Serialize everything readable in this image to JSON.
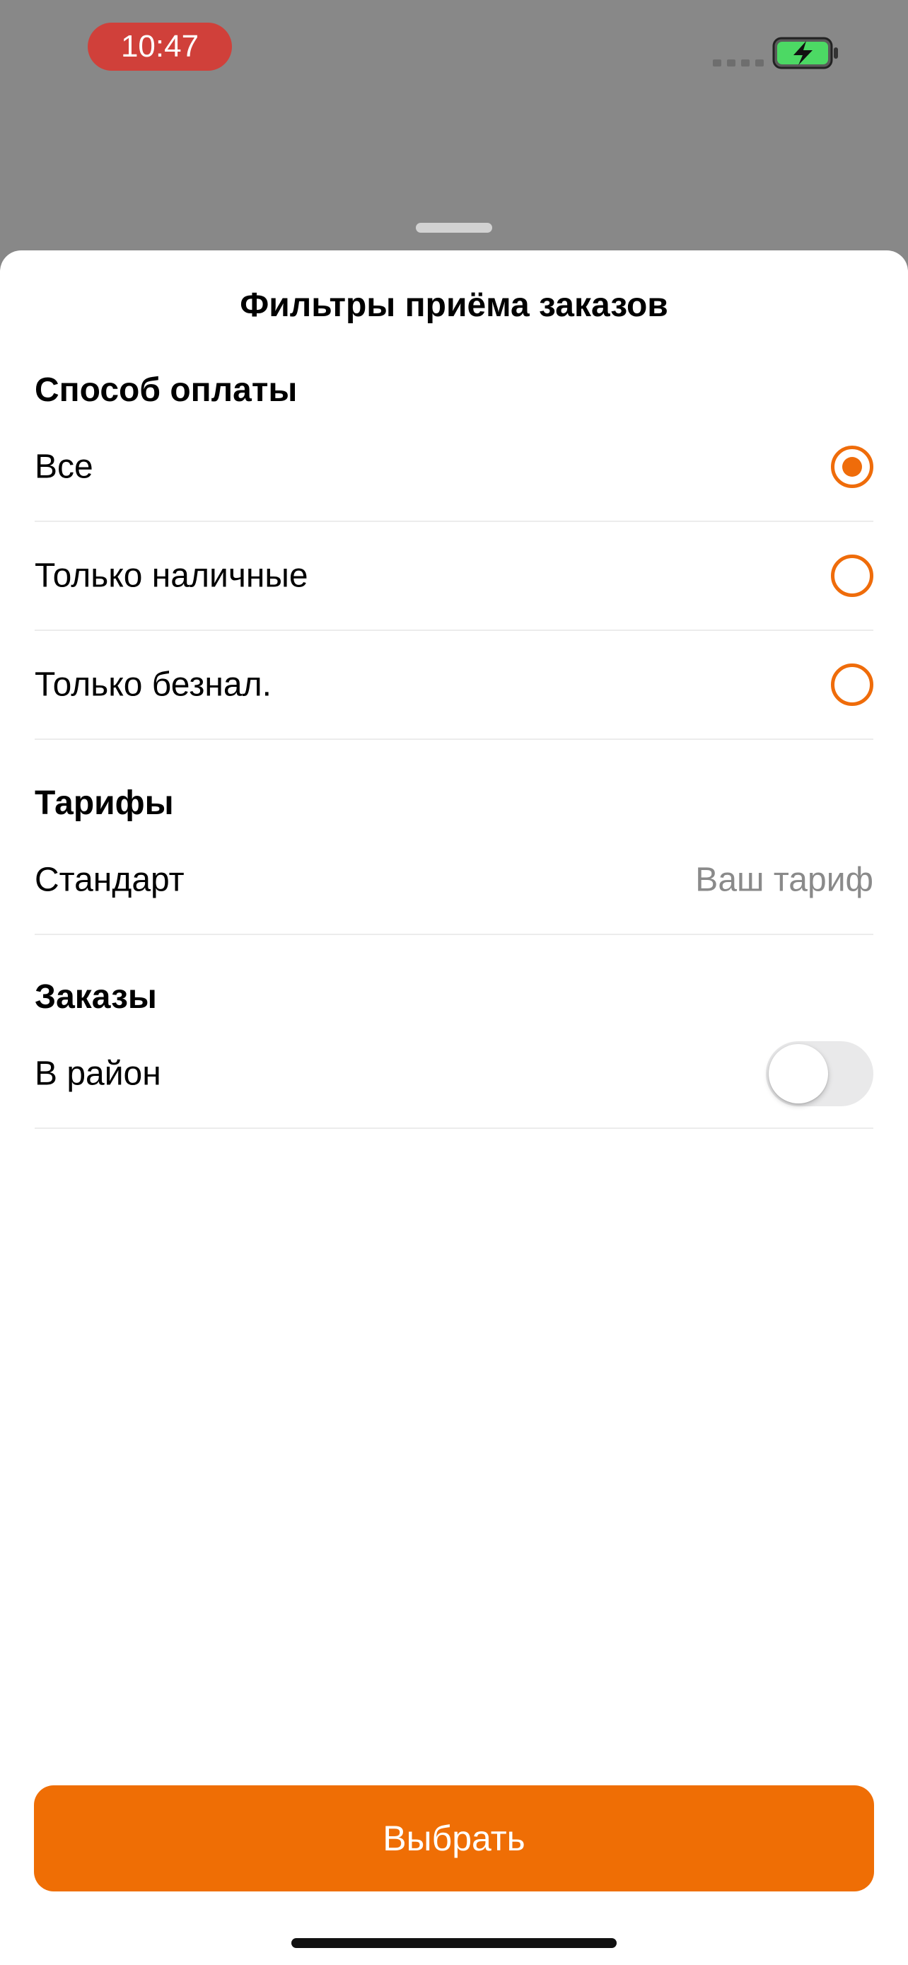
{
  "status_bar": {
    "time": "10:47",
    "icons": [
      "signal-icon",
      "battery-charging-icon"
    ],
    "battery_color": "#4cd964"
  },
  "sheet": {
    "title": "Фильтры приёма заказов"
  },
  "payment": {
    "title": "Способ оплаты",
    "options": [
      {
        "label": "Все",
        "selected": true
      },
      {
        "label": "Только наличные",
        "selected": false
      },
      {
        "label": "Только безнал.",
        "selected": false
      }
    ]
  },
  "tariffs": {
    "title": "Тарифы",
    "item_label": "Стандарт",
    "item_value": "Ваш тариф"
  },
  "orders": {
    "title": "Заказы",
    "item_label": "В район",
    "toggle_on": false
  },
  "actions": {
    "select_label": "Выбрать"
  },
  "colors": {
    "accent": "#ef6e05",
    "backdrop": "#888888",
    "time_pill": "#d0403a"
  }
}
